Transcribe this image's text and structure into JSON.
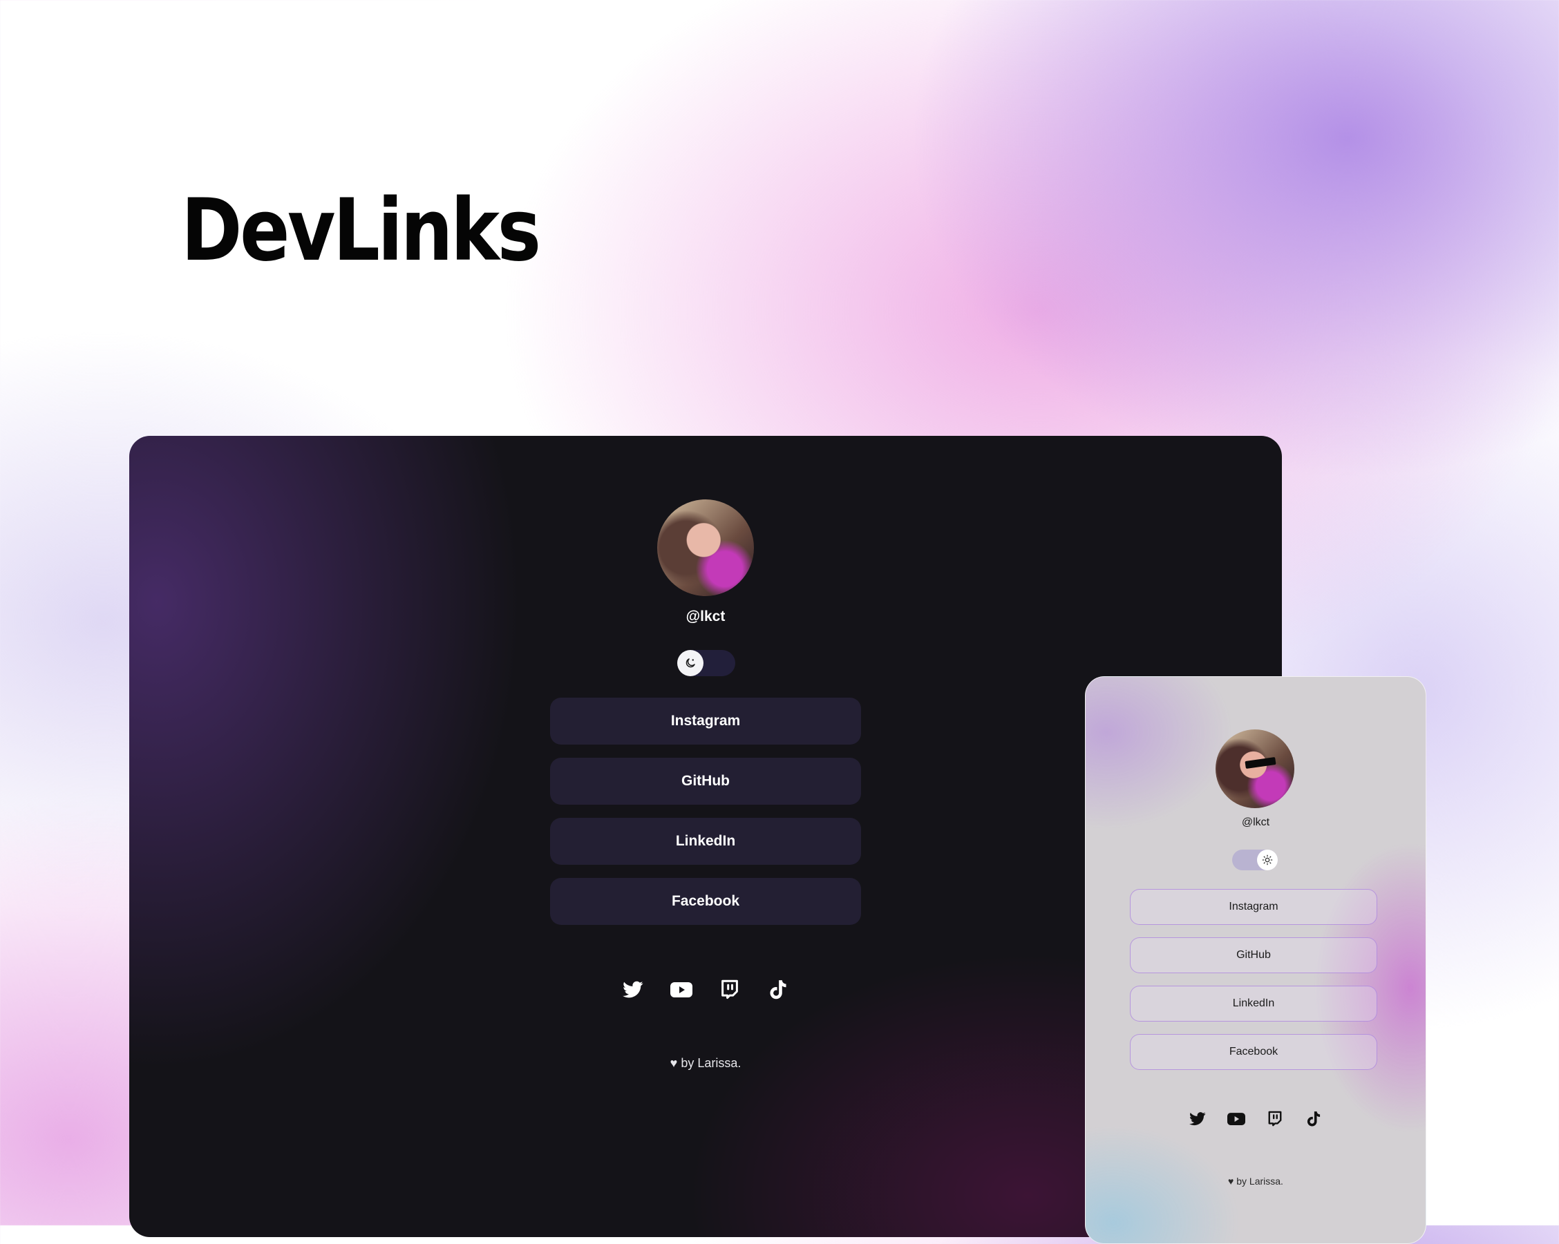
{
  "hero": {
    "title": "DevLinks"
  },
  "desktop": {
    "handle": "@lkct",
    "links": [
      {
        "label": "Instagram"
      },
      {
        "label": "GitHub"
      },
      {
        "label": "LinkedIn"
      },
      {
        "label": "Facebook"
      }
    ],
    "socials": [
      "twitter-icon",
      "youtube-icon",
      "twitch-icon",
      "tiktok-icon"
    ],
    "footer": "♥ by Larissa.",
    "theme": "dark"
  },
  "mobile": {
    "handle": "@lkct",
    "links": [
      {
        "label": "Instagram"
      },
      {
        "label": "GitHub"
      },
      {
        "label": "LinkedIn"
      },
      {
        "label": "Facebook"
      }
    ],
    "socials": [
      "twitter-icon",
      "youtube-icon",
      "twitch-icon",
      "tiktok-icon"
    ],
    "footer": "♥ by Larissa.",
    "theme": "light"
  },
  "colors": {
    "dark_card_bg": "#141318",
    "dark_button_bg": "#231f33",
    "light_card_bg": "#d3d0d3",
    "light_button_border": "#aa82dc"
  }
}
